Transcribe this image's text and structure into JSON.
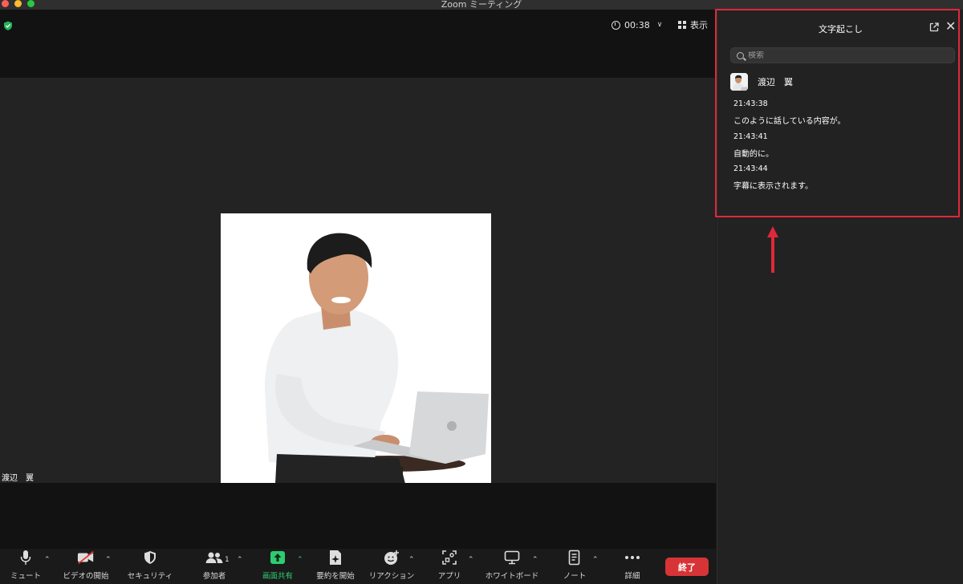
{
  "window": {
    "title": "Zoom ミーティング"
  },
  "meeting": {
    "timer": "00:38",
    "view_label": "表示",
    "participant_name": "渡辺　翼"
  },
  "toolbar": {
    "mute": "ミュート",
    "video": "ビデオの開始",
    "security": "セキュリティ",
    "participants": "参加者",
    "participants_count": "1",
    "share": "画面共有",
    "summary": "要約を開始",
    "reactions": "リアクション",
    "apps": "アプリ",
    "whiteboard": "ホワイトボード",
    "notes": "ノート",
    "more": "詳細",
    "end": "終了"
  },
  "transcript_panel": {
    "title": "文字起こし",
    "search_placeholder": "検索",
    "speaker": "渡辺　翼",
    "entries": [
      {
        "time": "21:43:38",
        "text": "このように話している内容が。"
      },
      {
        "time": "21:43:41",
        "text": "自動的に。"
      },
      {
        "time": "21:43:44",
        "text": "字幕に表示されます。"
      }
    ]
  },
  "colors": {
    "share_green": "#2ecc71",
    "end_red": "#d63436",
    "highlight_red": "#e0283a"
  }
}
